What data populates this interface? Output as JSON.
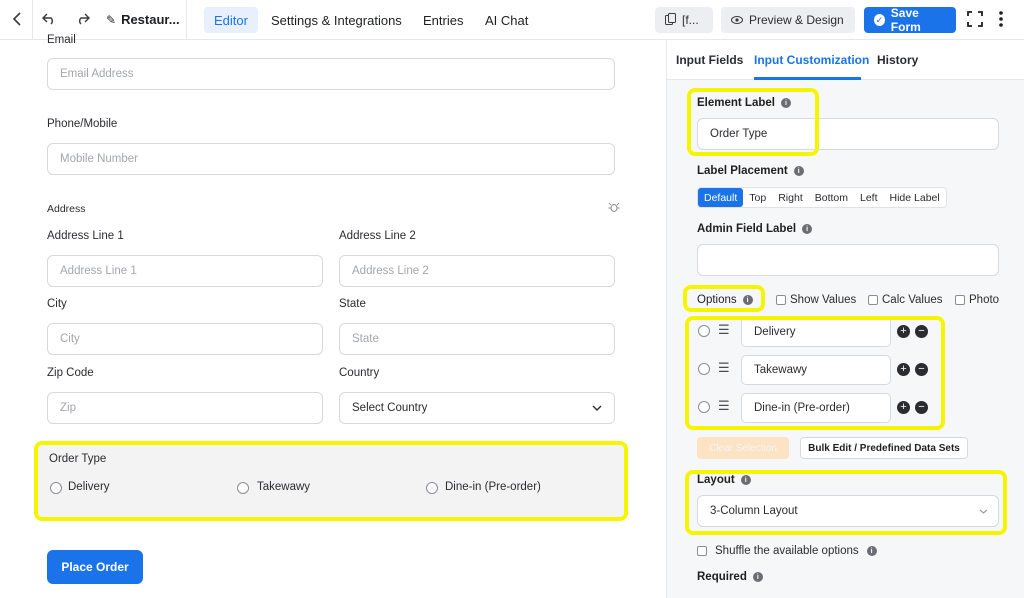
{
  "topbar": {
    "form_title": "Restaur...",
    "tabs": [
      "Editor",
      "Settings & Integrations",
      "Entries",
      "AI Chat"
    ],
    "shortcode_label": "[f...",
    "preview_label": "Preview & Design",
    "save_label": "Save Form"
  },
  "form": {
    "email_label": "Email",
    "email_placeholder": "Email Address",
    "phone_label": "Phone/Mobile",
    "phone_placeholder": "Mobile Number",
    "address_label": "Address",
    "address1_label": "Address Line 1",
    "address1_placeholder": "Address Line 1",
    "address2_label": "Address Line 2",
    "address2_placeholder": "Address Line 2",
    "city_label": "City",
    "city_placeholder": "City",
    "state_label": "State",
    "state_placeholder": "State",
    "zip_label": "Zip Code",
    "zip_placeholder": "Zip",
    "country_label": "Country",
    "country_value": "Select Country",
    "order_type_label": "Order Type",
    "order_options": [
      "Delivery",
      "Takewawy",
      "Dine-in (Pre-order)"
    ],
    "submit_label": "Place Order"
  },
  "sidebar": {
    "tabs": [
      "Input Fields",
      "Input Customization",
      "History"
    ],
    "element_label_title": "Element Label",
    "element_label_value": "Order Type",
    "label_placement_title": "Label Placement",
    "placements": [
      "Default",
      "Top",
      "Right",
      "Bottom",
      "Left",
      "Hide Label"
    ],
    "admin_label_title": "Admin Field Label",
    "options_title": "Options",
    "show_values": "Show Values",
    "calc_values": "Calc Values",
    "photo": "Photo",
    "options": [
      "Delivery",
      "Takewawy",
      "Dine-in (Pre-order)"
    ],
    "clear_selection": "Clear Selection",
    "bulk_edit": "Bulk Edit / Predefined Data Sets",
    "layout_title": "Layout",
    "layout_value": "3-Column Layout",
    "shuffle_label": "Shuffle the available options",
    "required_title": "Required"
  },
  "colors": {
    "accent": "#1a73e8",
    "highlight": "#f5f500"
  }
}
